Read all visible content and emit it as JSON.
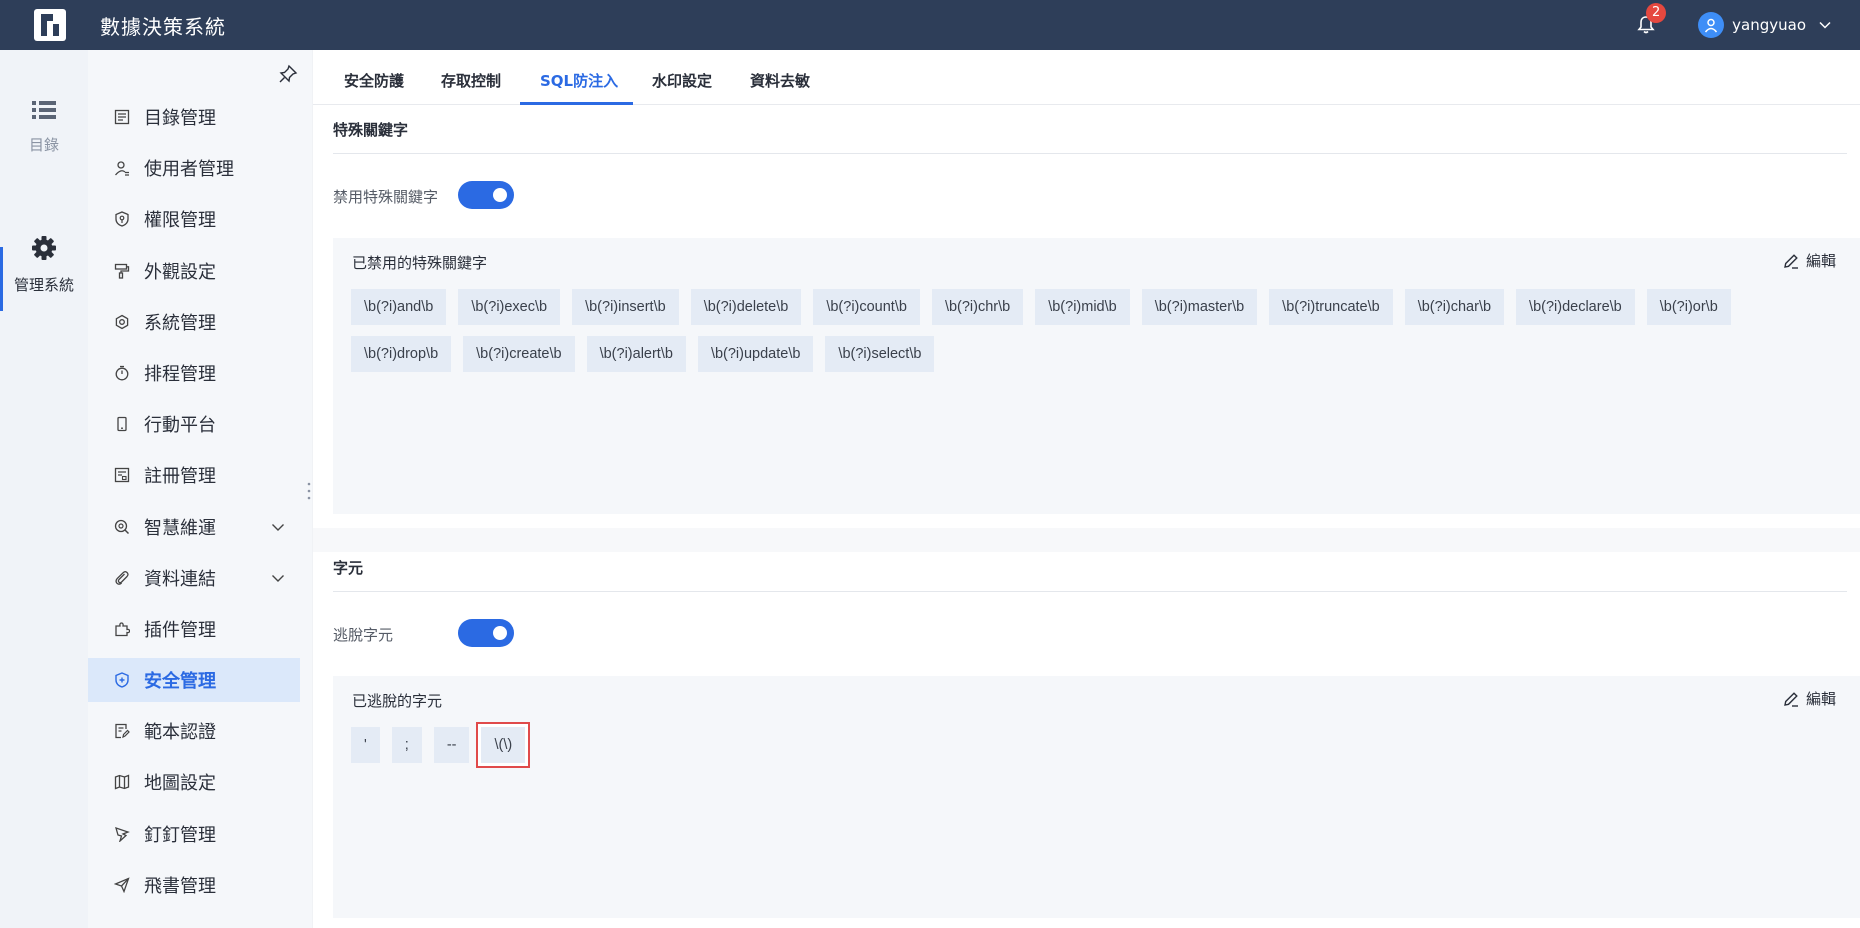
{
  "header": {
    "app_title": "數據決策系統",
    "notification_count": "2",
    "username": "yangyuao"
  },
  "rail": {
    "items": [
      {
        "label": "目錄",
        "icon": "list-icon"
      },
      {
        "label": "管理系統",
        "icon": "gear-icon",
        "active": true
      }
    ]
  },
  "sidebar": {
    "items": [
      {
        "label": "目錄管理",
        "icon": "catalog-icon"
      },
      {
        "label": "使用者管理",
        "icon": "user-icon"
      },
      {
        "label": "權限管理",
        "icon": "permission-icon"
      },
      {
        "label": "外觀設定",
        "icon": "paint-roller-icon"
      },
      {
        "label": "系統管理",
        "icon": "settings-icon"
      },
      {
        "label": "排程管理",
        "icon": "timer-icon"
      },
      {
        "label": "行動平台",
        "icon": "mobile-icon"
      },
      {
        "label": "註冊管理",
        "icon": "register-icon"
      },
      {
        "label": "智慧維運",
        "icon": "smart-ops-icon",
        "expandable": true
      },
      {
        "label": "資料連結",
        "icon": "paperclip-icon",
        "expandable": true
      },
      {
        "label": "插件管理",
        "icon": "puzzle-icon"
      },
      {
        "label": "安全管理",
        "icon": "shield-icon",
        "active": true
      },
      {
        "label": "範本認證",
        "icon": "template-icon"
      },
      {
        "label": "地圖設定",
        "icon": "map-icon"
      },
      {
        "label": "釘釘管理",
        "icon": "dingtalk-icon"
      },
      {
        "label": "飛書管理",
        "icon": "paper-plane-icon"
      }
    ]
  },
  "tabs": [
    {
      "label": "安全防護"
    },
    {
      "label": "存取控制"
    },
    {
      "label": "SQL防注入",
      "active": true
    },
    {
      "label": "水印設定"
    },
    {
      "label": "資料去敏"
    }
  ],
  "keywords_section": {
    "title": "特殊關鍵字",
    "toggle_label": "禁用特殊關鍵字",
    "toggle_on": true,
    "panel_title": "已禁用的特殊關鍵字",
    "edit_label": "編輯",
    "tags": [
      "\\b(?i)and\\b",
      "\\b(?i)exec\\b",
      "\\b(?i)insert\\b",
      "\\b(?i)delete\\b",
      "\\b(?i)count\\b",
      "\\b(?i)chr\\b",
      "\\b(?i)mid\\b",
      "\\b(?i)master\\b",
      "\\b(?i)truncate\\b",
      "\\b(?i)char\\b",
      "\\b(?i)declare\\b",
      "\\b(?i)or\\b",
      "\\b(?i)drop\\b",
      "\\b(?i)create\\b",
      "\\b(?i)alert\\b",
      "\\b(?i)update\\b",
      "\\b(?i)select\\b"
    ]
  },
  "chars_section": {
    "title": "字元",
    "toggle_label": "逃脫字元",
    "toggle_on": true,
    "panel_title": "已逃脫的字元",
    "edit_label": "編輯",
    "tags": [
      "'",
      ";",
      "--",
      "\\(\\)"
    ]
  },
  "colors": {
    "header_bg": "#2e3e59",
    "accent": "#2b6ae3",
    "badge": "#e5483f",
    "highlight_border": "#e04a4a"
  }
}
